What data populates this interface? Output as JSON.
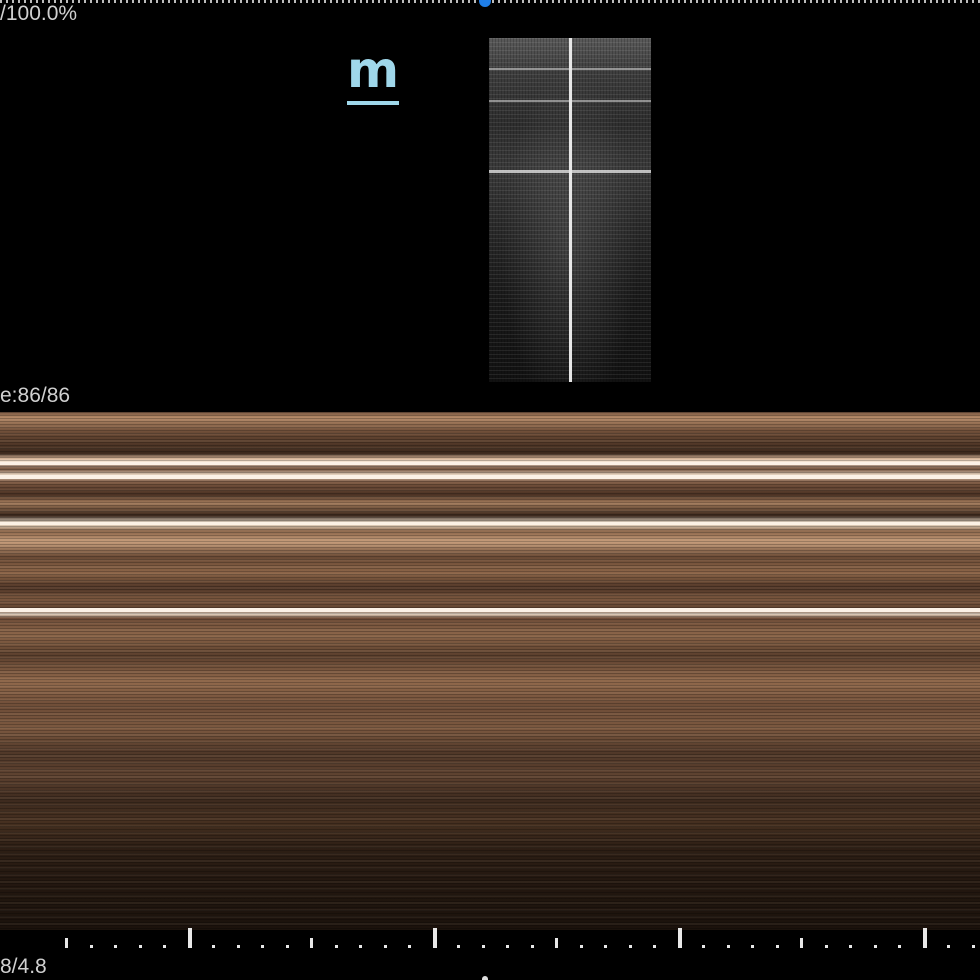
{
  "overlay": {
    "gain": "/100.0%",
    "frame": "e:86/86",
    "scale": "8/4.8"
  },
  "mode_logo": "m",
  "icons": {
    "mode_logo": "m-mode-icon",
    "marker": "sweep-position-marker"
  },
  "colors": {
    "accent": "#1f7ee8",
    "logo": "#9fd7ea",
    "trace_tint": "#b58a68"
  }
}
